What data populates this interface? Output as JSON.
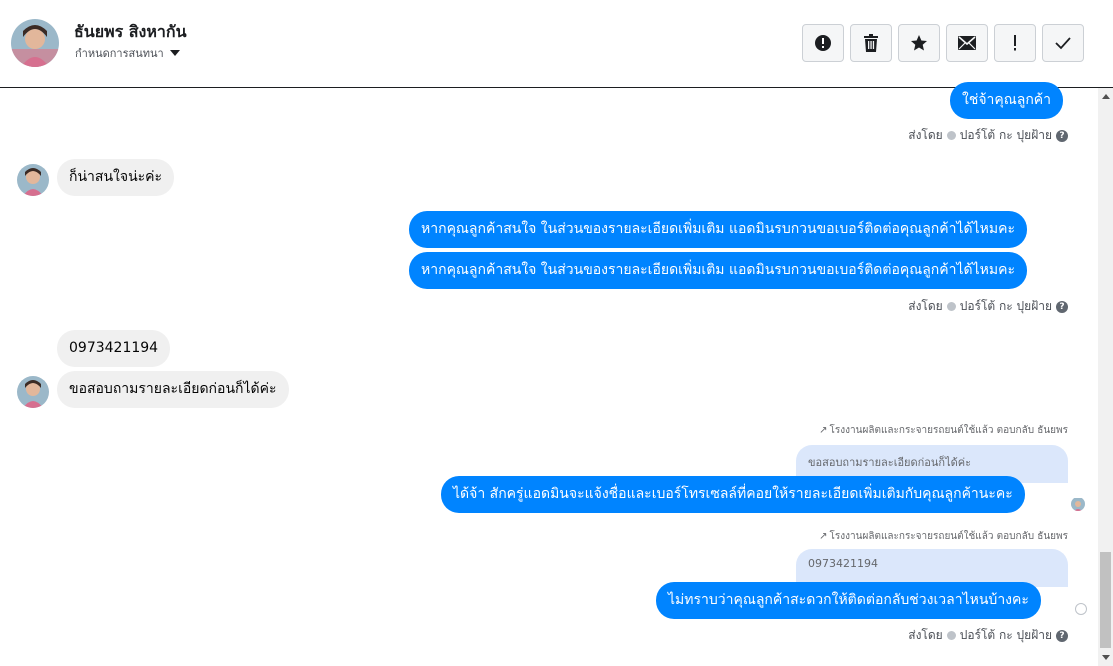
{
  "header": {
    "contact_name": "ธันยพร สิงหากัน",
    "conversation_settings": "กำหนดการสนทนา",
    "toolbar": [
      {
        "icon": "alert-circle-icon"
      },
      {
        "icon": "trash-icon"
      },
      {
        "icon": "star-icon"
      },
      {
        "icon": "envelope-icon"
      },
      {
        "icon": "exclamation-icon"
      },
      {
        "icon": "checkmark-icon"
      }
    ]
  },
  "messages": {
    "m1": "ใช่จ้าคุณลูกค้า",
    "m2": "ก็น่าสนใจน่ะค่ะ",
    "m3": "หากคุณลูกค้าสนใจ ในส่วนของรายละเอียดเพิ่มเติม แอดมินรบกวนขอเบอร์ติดต่อคุณลูกค้าได้ไหมคะ",
    "m4": "หากคุณลูกค้าสนใจ ในส่วนของรายละเอียดเพิ่มเติม แอดมินรบกวนขอเบอร์ติดต่อคุณลูกค้าได้ไหมคะ",
    "m5": "0973421194",
    "m6": "ขอสอบถามรายละเอียดก่อนก็ได้ค่ะ",
    "m7_reply_note": "โรงงานผลิตและกระจายรถยนต์ใช้แล้ว ตอบกลับ ธันยพร",
    "m7_quoted": "ขอสอบถามรายละเอียดก่อนก็ได้ค่ะ",
    "m7": "ได้จ้า สักครู่แอดมินจะแจ้งชื่อและเบอร์โทรเซลล์ที่คอยให้รายละเอียดเพิ่มเติมกับคุณลูกค้านะคะ",
    "m8_reply_note": "โรงงานผลิตและกระจายรถยนต์ใช้แล้ว ตอบกลับ ธันยพร",
    "m8_quoted": "0973421194",
    "m8": "ไม่ทราบว่าคุณลูกค้าสะดวกให้ติดต่อกลับช่วงเวลาไหนบ้างคะ"
  },
  "sent_by": {
    "label": "ส่งโดย",
    "agent": "ปอร์โต้ กะ ปุยฝ้าย"
  },
  "colors": {
    "outgoing_bubble": "#0084ff",
    "incoming_bubble": "#f0f0f0",
    "quoted_bubble": "#dbe7fb"
  }
}
